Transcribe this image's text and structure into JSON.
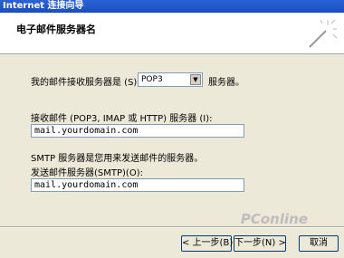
{
  "window": {
    "title": "Internet 连接向导"
  },
  "header": {
    "title": "电子邮件服务器名"
  },
  "incoming": {
    "label": "我的邮件接收服务器是 (S)",
    "type_value": "POP3",
    "suffix": "服务器。",
    "server_label": "接收邮件 (POP3, IMAP 或 HTTP) 服务器 (I):",
    "server_value": "mail.yourdomain.com"
  },
  "outgoing": {
    "note": "SMTP 服务器是您用来发送邮件的服务器。",
    "server_label": "发送邮件服务器(SMTP)(O):",
    "server_value": "mail.yourdomain.com"
  },
  "buttons": {
    "back": "< 上一步(B)",
    "next": "下一步(N) >",
    "cancel": "取消"
  },
  "watermark": "PConline"
}
